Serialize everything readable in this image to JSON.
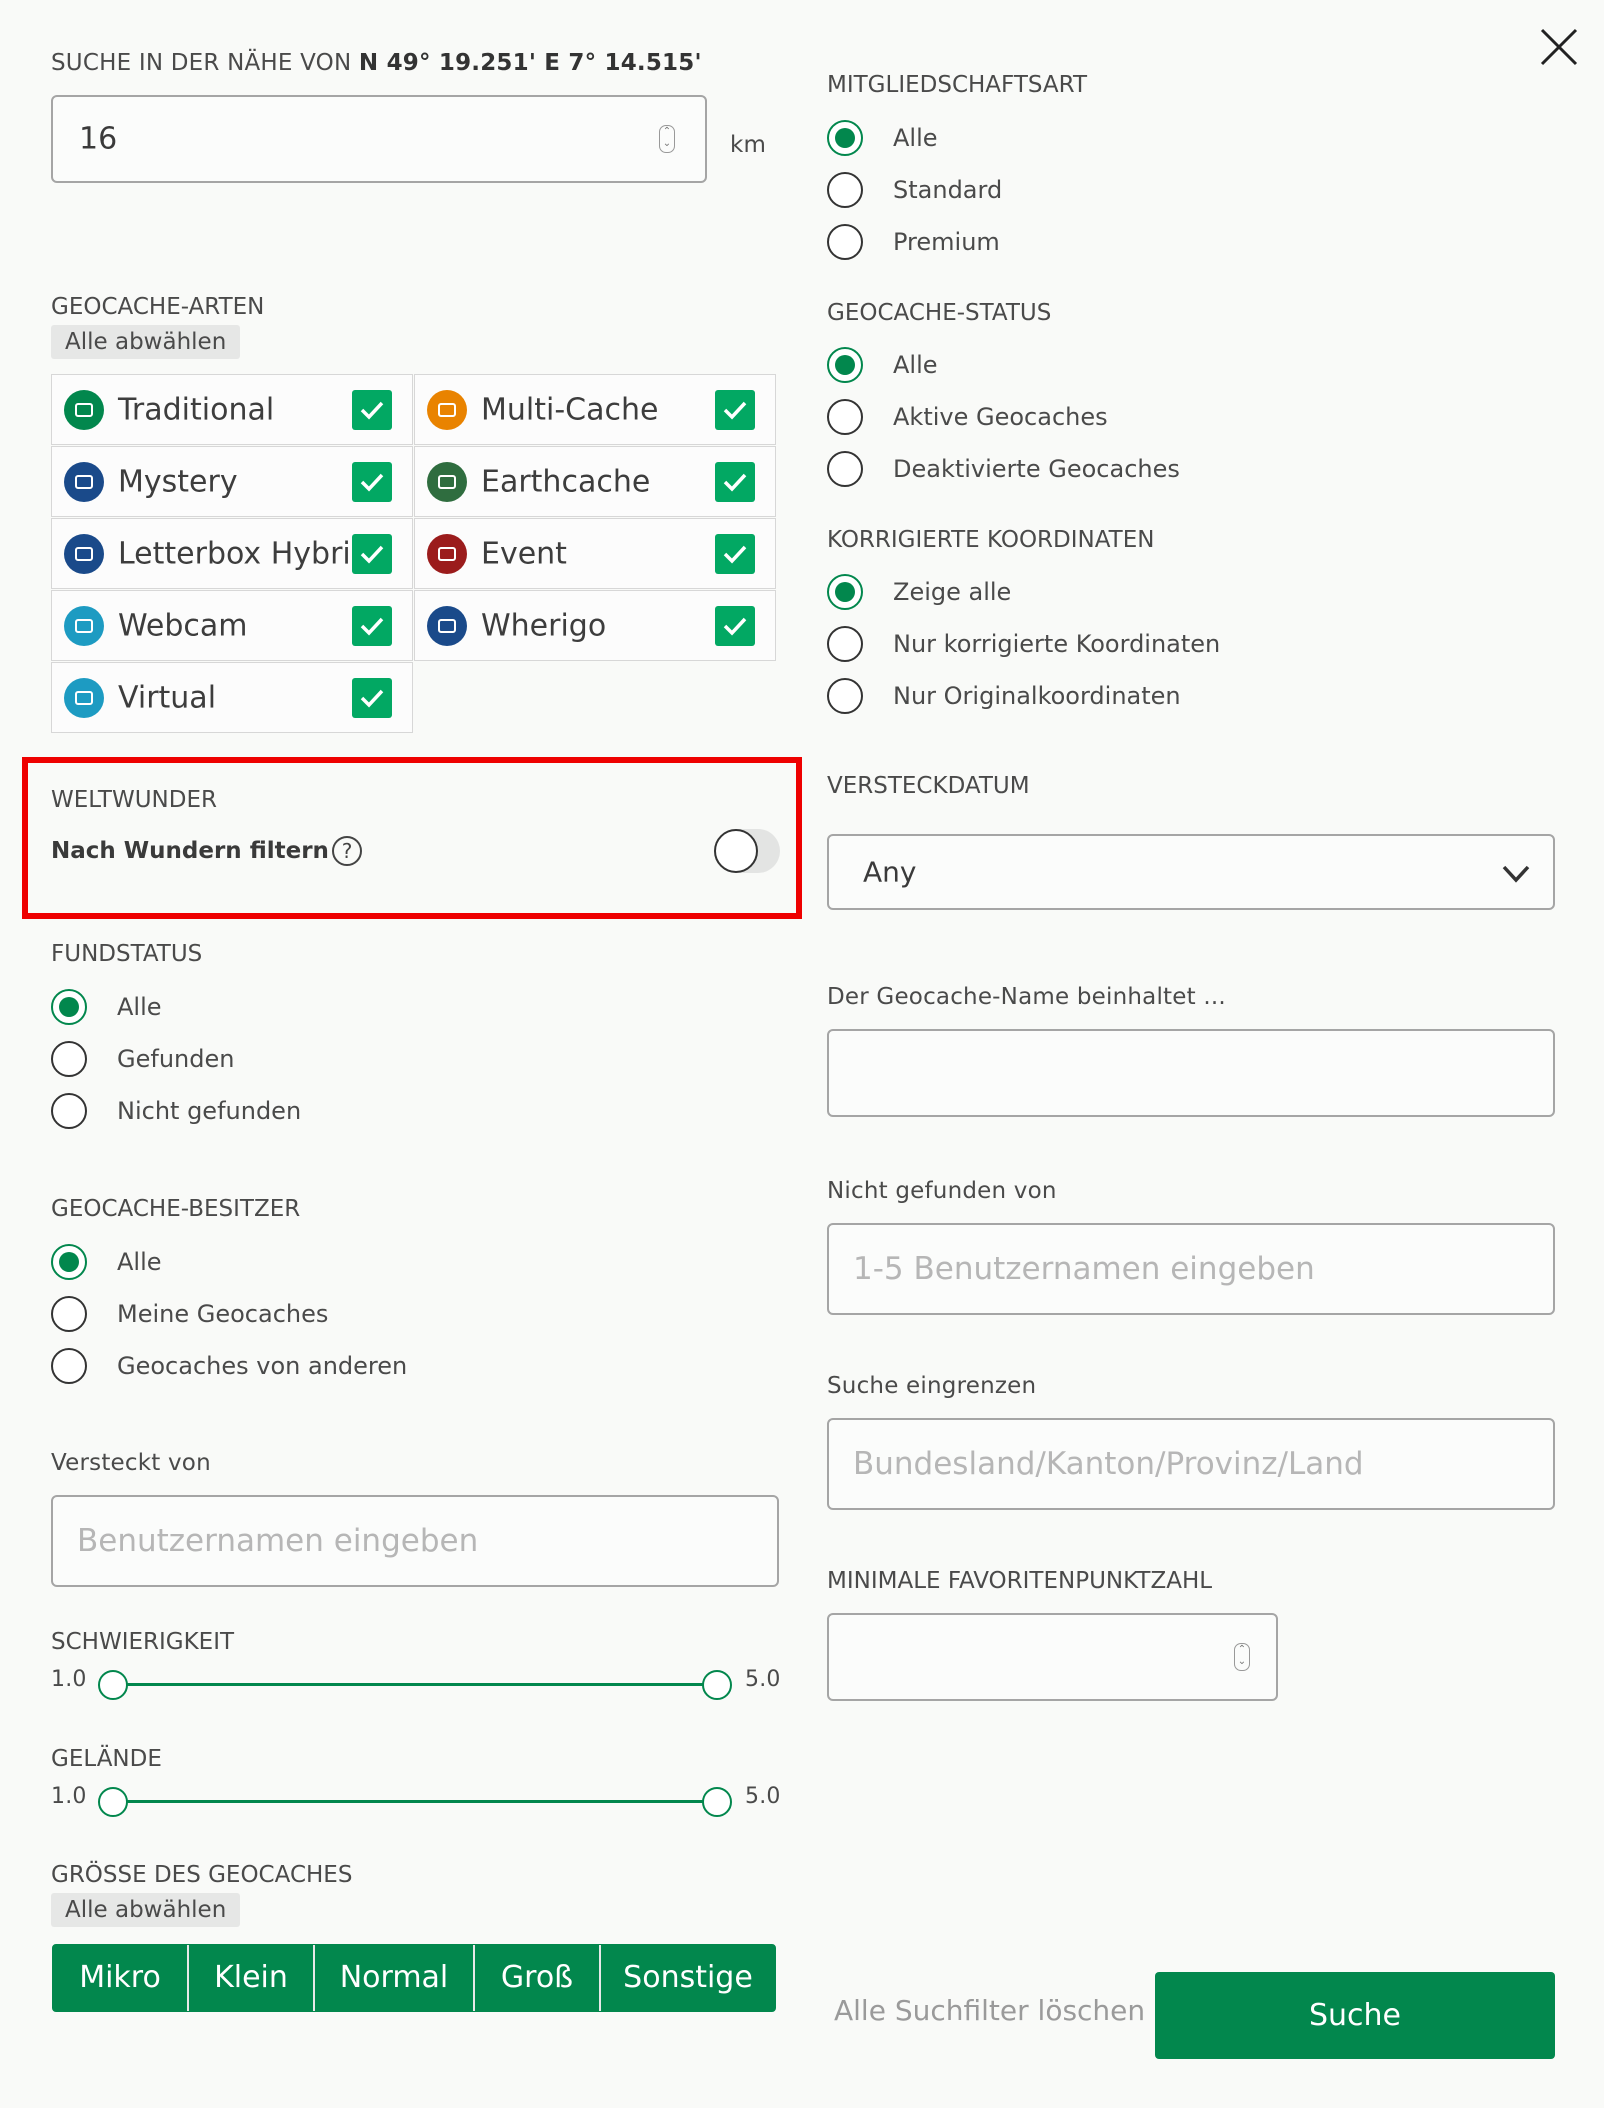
{
  "close": {
    "icon": "close-icon"
  },
  "nearby": {
    "label_prefix": "SUCHE IN DER NÄHE VON ",
    "coords": "N 49° 19.251' E 7° 14.515'",
    "radius_value": "16",
    "unit": "km"
  },
  "types": {
    "heading": "GEOCACHE-ARTEN",
    "deselect": "Alle abwählen",
    "items": [
      {
        "name": "Traditional",
        "icon": "traditional-icon",
        "color": "#02874d",
        "checked": true
      },
      {
        "name": "Multi-Cache",
        "icon": "multi-cache-icon",
        "color": "#e98300",
        "checked": true
      },
      {
        "name": "Mystery",
        "icon": "mystery-icon",
        "color": "#1a4a8a",
        "checked": true
      },
      {
        "name": "Earthcache",
        "icon": "earthcache-icon",
        "color": "#2f6d3f",
        "checked": true
      },
      {
        "name": "Letterbox Hybrid",
        "icon": "letterbox-icon",
        "color": "#1a4a8a",
        "checked": true
      },
      {
        "name": "Event",
        "icon": "event-icon",
        "color": "#9b1c1c",
        "checked": true
      },
      {
        "name": "Webcam",
        "icon": "webcam-icon",
        "color": "#1d9bc2",
        "checked": true
      },
      {
        "name": "Wherigo",
        "icon": "wherigo-icon",
        "color": "#1a4a8a",
        "checked": true
      },
      {
        "name": "Virtual",
        "icon": "virtual-icon",
        "color": "#1d9bc2",
        "checked": true
      }
    ]
  },
  "wonders": {
    "heading": "WELTWUNDER",
    "toggle_label": "Nach Wundern filtern",
    "help_icon": "help-icon",
    "enabled": false
  },
  "found_status": {
    "heading": "FUNDSTATUS",
    "options": [
      "Alle",
      "Gefunden",
      "Nicht gefunden"
    ],
    "selected": 0
  },
  "owner": {
    "heading": "GEOCACHE-BESITZER",
    "options": [
      "Alle",
      "Meine Geocaches",
      "Geocaches von anderen"
    ],
    "selected": 0
  },
  "hidden_by": {
    "label": "Versteckt von",
    "placeholder": "Benutzernamen eingeben"
  },
  "difficulty": {
    "heading": "SCHWIERIGKEIT",
    "min": "1.0",
    "max": "5.0"
  },
  "terrain": {
    "heading": "GELÄNDE",
    "min": "1.0",
    "max": "5.0"
  },
  "size": {
    "heading": "GRÖSSE DES GEOCACHES",
    "deselect": "Alle abwählen",
    "options": [
      "Mikro",
      "Klein",
      "Normal",
      "Groß",
      "Sonstige"
    ]
  },
  "membership": {
    "heading": "MITGLIEDSCHAFTSART",
    "options": [
      "Alle",
      "Standard",
      "Premium"
    ],
    "selected": 0
  },
  "cache_status": {
    "heading": "GEOCACHE-STATUS",
    "options": [
      "Alle",
      "Aktive Geocaches",
      "Deaktivierte Geocaches"
    ],
    "selected": 0
  },
  "corrected": {
    "heading": "KORRIGIERTE KOORDINATEN",
    "options": [
      "Zeige alle",
      "Nur korrigierte Koordinaten",
      "Nur Originalkoordinaten"
    ],
    "selected": 0
  },
  "hidden_date": {
    "heading": "VERSTECKDATUM",
    "value": "Any"
  },
  "name_contains": {
    "label": "Der Geocache-Name beinhaltet ..."
  },
  "not_found_by": {
    "label": "Nicht gefunden von",
    "placeholder": "1-5 Benutzernamen eingeben"
  },
  "narrow": {
    "label": "Suche eingrenzen",
    "placeholder": "Bundesland/Kanton/Provinz/Land"
  },
  "min_fav": {
    "heading": "MINIMALE FAVORITENPUNKTZAHL"
  },
  "actions": {
    "clear": "Alle Suchfilter löschen",
    "search": "Suche"
  },
  "colors": {
    "accent": "#02874d",
    "checkbox": "#02a863",
    "highlight": "#ee0000"
  }
}
